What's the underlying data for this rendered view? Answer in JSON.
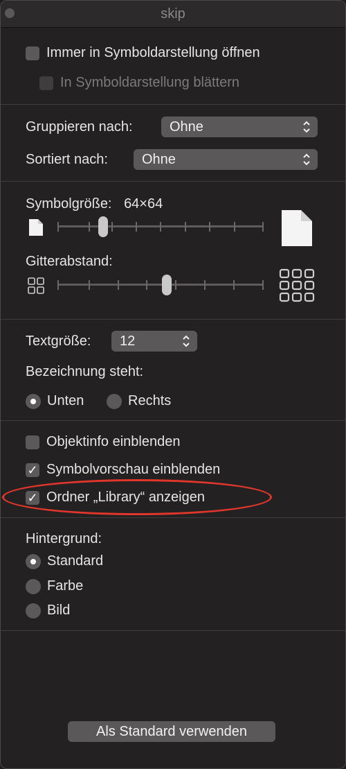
{
  "window": {
    "title": "skip"
  },
  "view_options": {
    "always_open_icon_view": {
      "label": "Immer in Symboldarstellung öffnen",
      "checked": false
    },
    "browse_icon_view": {
      "label": "In Symboldarstellung blättern",
      "checked": false,
      "enabled": false
    },
    "group_by": {
      "label": "Gruppieren nach:",
      "value": "Ohne"
    },
    "sort_by": {
      "label": "Sortiert nach:",
      "value": "Ohne"
    },
    "icon_size": {
      "label": "Symbolgröße:",
      "value_text": "64×64",
      "slider_fraction": 0.22
    },
    "grid_spacing": {
      "label": "Gitterabstand:",
      "slider_fraction": 0.53
    },
    "text_size": {
      "label": "Textgröße:",
      "value": "12"
    },
    "label_position": {
      "label": "Bezeichnung steht:",
      "options": [
        {
          "label": "Unten",
          "selected": true
        },
        {
          "label": "Rechts",
          "selected": false
        }
      ]
    },
    "show_item_info": {
      "label": "Objektinfo einblenden",
      "checked": false
    },
    "show_icon_preview": {
      "label": "Symbolvorschau einblenden",
      "checked": true
    },
    "show_library_folder": {
      "label": "Ordner „Library“ anzeigen",
      "checked": true
    },
    "background": {
      "label": "Hintergrund:",
      "options": [
        {
          "label": "Standard",
          "selected": true
        },
        {
          "label": "Farbe",
          "selected": false
        },
        {
          "label": "Bild",
          "selected": false
        }
      ]
    },
    "use_as_default_button": {
      "label": "Als Standard verwenden"
    }
  },
  "icons": {
    "checkmark": "✓",
    "updown": "⌃⌄"
  },
  "colors": {
    "highlight": "#e0362c",
    "control": "#5a5858",
    "background": "#232121"
  }
}
